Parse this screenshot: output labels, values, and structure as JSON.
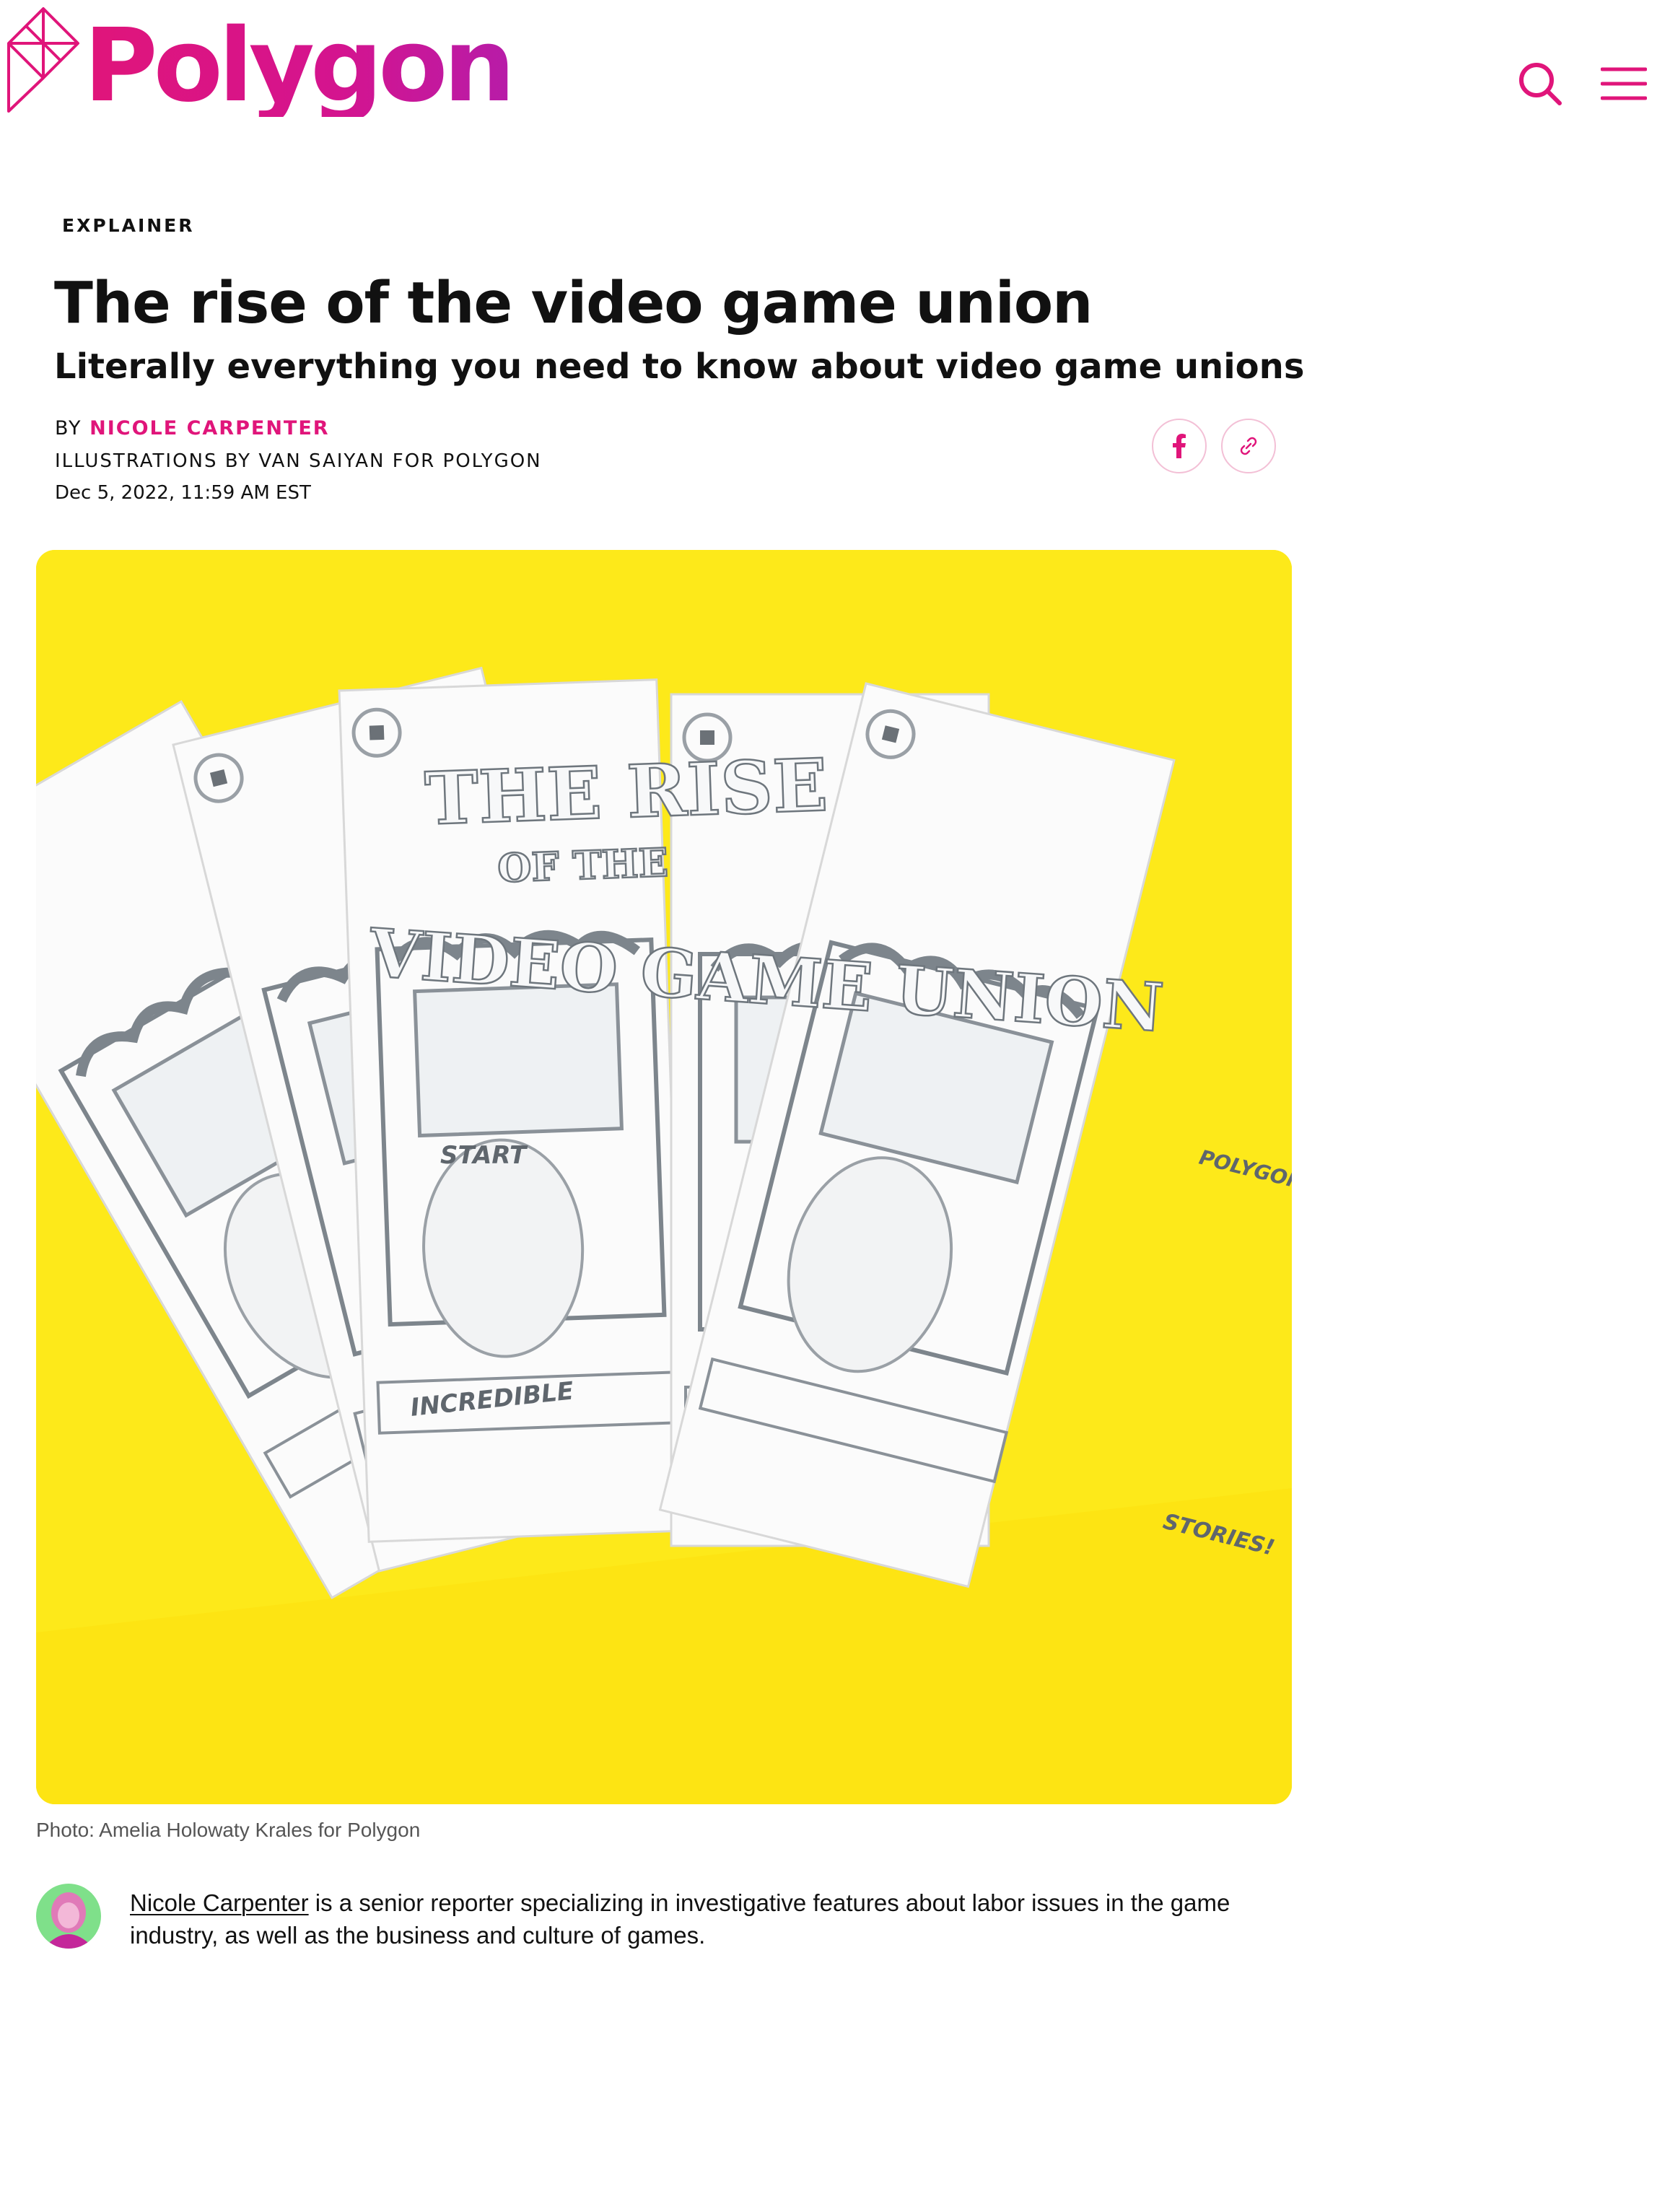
{
  "site": {
    "name": "Polygon",
    "brand_color": "#e0157a",
    "icons": {
      "search": "search-icon",
      "menu": "hamburger-menu-icon",
      "facebook": "facebook-icon",
      "link": "link-icon"
    }
  },
  "article": {
    "kicker": "EXPLAINER",
    "title": "The rise of the video game union",
    "subtitle": "Literally everything you need to know about video game unions",
    "byline_prefix": "BY ",
    "author": "NICOLE CARPENTER",
    "illustration_credit": "ILLUSTRATIONS BY VAN SAIYAN FOR POLYGON",
    "date": "Dec 5, 2022, 11:59 AM EST"
  },
  "hero": {
    "background_color": "#fde91a",
    "zine_title_lines": [
      "THE RISE",
      "OF THE",
      "VIDEO GAME UNION"
    ],
    "zine_screen_text": "START",
    "zine_footer_text": "INCREDIBLE",
    "zine_footer_text_alt": "STORIES!",
    "zine_byline": "POLYGON",
    "caption": "Photo: Amelia Holowaty Krales for Polygon"
  },
  "author_bio": {
    "name_link": "Nicole Carpenter",
    "text": " is a senior reporter specializing in investigative features about labor issues in the game industry, as well as the business and culture of games."
  }
}
